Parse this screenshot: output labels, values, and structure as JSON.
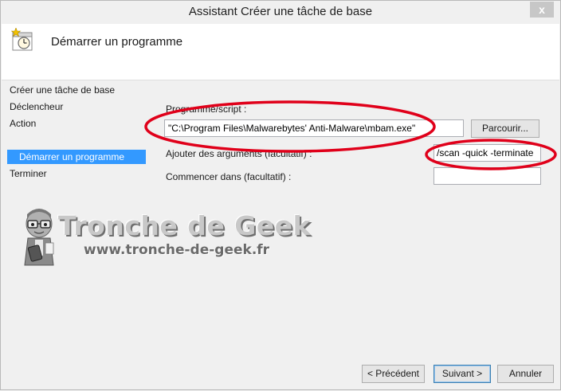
{
  "window": {
    "title": "Assistant Créer une tâche de base",
    "close_glyph": "x"
  },
  "header": {
    "icon": "task-scheduler-icon",
    "title": "Démarrer un programme"
  },
  "steps": [
    {
      "label": "Créer une tâche de base"
    },
    {
      "label": "Déclencheur"
    },
    {
      "label": "Action"
    },
    {
      "label": "Démarrer un programme"
    },
    {
      "label": "Terminer"
    }
  ],
  "form": {
    "program_label": "Programme/script :",
    "program_value": "\"C:\\Program Files\\Malwarebytes' Anti-Malware\\mbam.exe\"",
    "browse_label": "Parcourir...",
    "args_label": "Ajouter des arguments (facultatif) :",
    "args_value": "/scan -quick -terminate",
    "start_in_label": "Commencer dans (facultatif) :",
    "start_in_value": ""
  },
  "footer": {
    "back_label": "< Précédent",
    "next_label": "Suivant >",
    "cancel_label": "Annuler"
  },
  "watermark": {
    "brand": "Tronche de Geek",
    "url": "www.tronche-de-geek.fr"
  },
  "colors": {
    "selection": "#3399ff",
    "annotation": "#e0001a"
  }
}
